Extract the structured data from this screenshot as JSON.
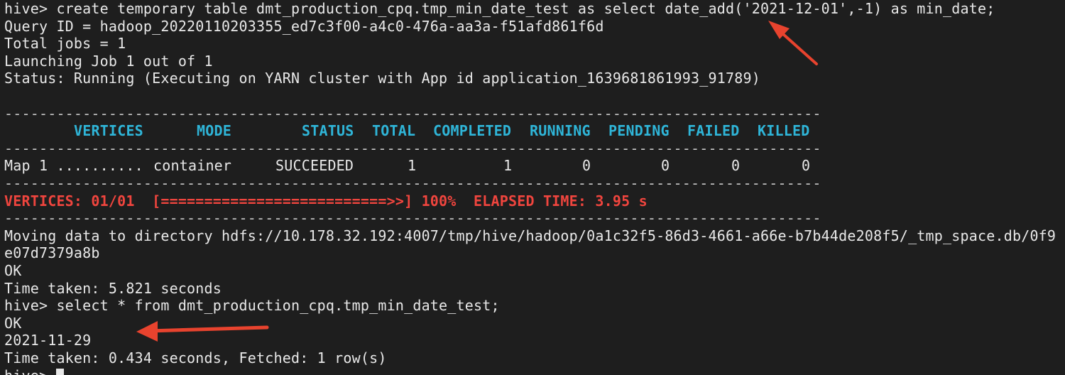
{
  "terminal": {
    "lines": {
      "l0": "hive> create temporary table dmt_production_cpq.tmp_min_date_test as select date_add('2021-12-01',-1) as min_date;",
      "l1": "Query ID = hadoop_20220110203355_ed7c3f00-a4c0-476a-aa3a-f51afd861f6d",
      "l2": "Total jobs = 1",
      "l3": "Launching Job 1 out of 1",
      "l4": "Status: Running (Executing on YARN cluster with App id application_1639681861993_91789)",
      "sep": "----------------------------------------------------------------------------------------------",
      "progress_label": "VERTICES: 01/01  [==========================>>] 100%  ELAPSED TIME: 3.95 s",
      "l13": "Moving data to directory hdfs://10.178.32.192:4007/tmp/hive/hadoop/0a1c32f5-86d3-4661-a66e-b7b44de208f5/_tmp_space.db/0f9",
      "l14": "e07d7379a8b",
      "l15": "OK",
      "l16": "Time taken: 5.821 seconds",
      "l17": "hive> select * from dmt_production_cpq.tmp_min_date_test;",
      "l18": "OK",
      "l19": "2021-11-29",
      "l20": "Time taken: 0.434 seconds, Fetched: 1 row(s)",
      "l21": "hive> "
    },
    "table": {
      "headers": {
        "vertices": "VERTICES",
        "mode": "MODE",
        "status": "STATUS",
        "total": "TOTAL",
        "completed": "COMPLETED",
        "running": "RUNNING",
        "pending": "PENDING",
        "failed": "FAILED",
        "killed": "KILLED"
      },
      "row": {
        "vertices": "Map 1 ..........",
        "mode": "container",
        "status": "SUCCEEDED",
        "total": "1",
        "completed": "1",
        "running": "0",
        "pending": "0",
        "failed": "0",
        "killed": "0"
      }
    },
    "colors": {
      "background": "#1e1e1e",
      "text": "#e8e8e8",
      "header": "#2fb5d8",
      "progress": "#f0453e",
      "annotation_arrow": "#e8432e"
    }
  }
}
